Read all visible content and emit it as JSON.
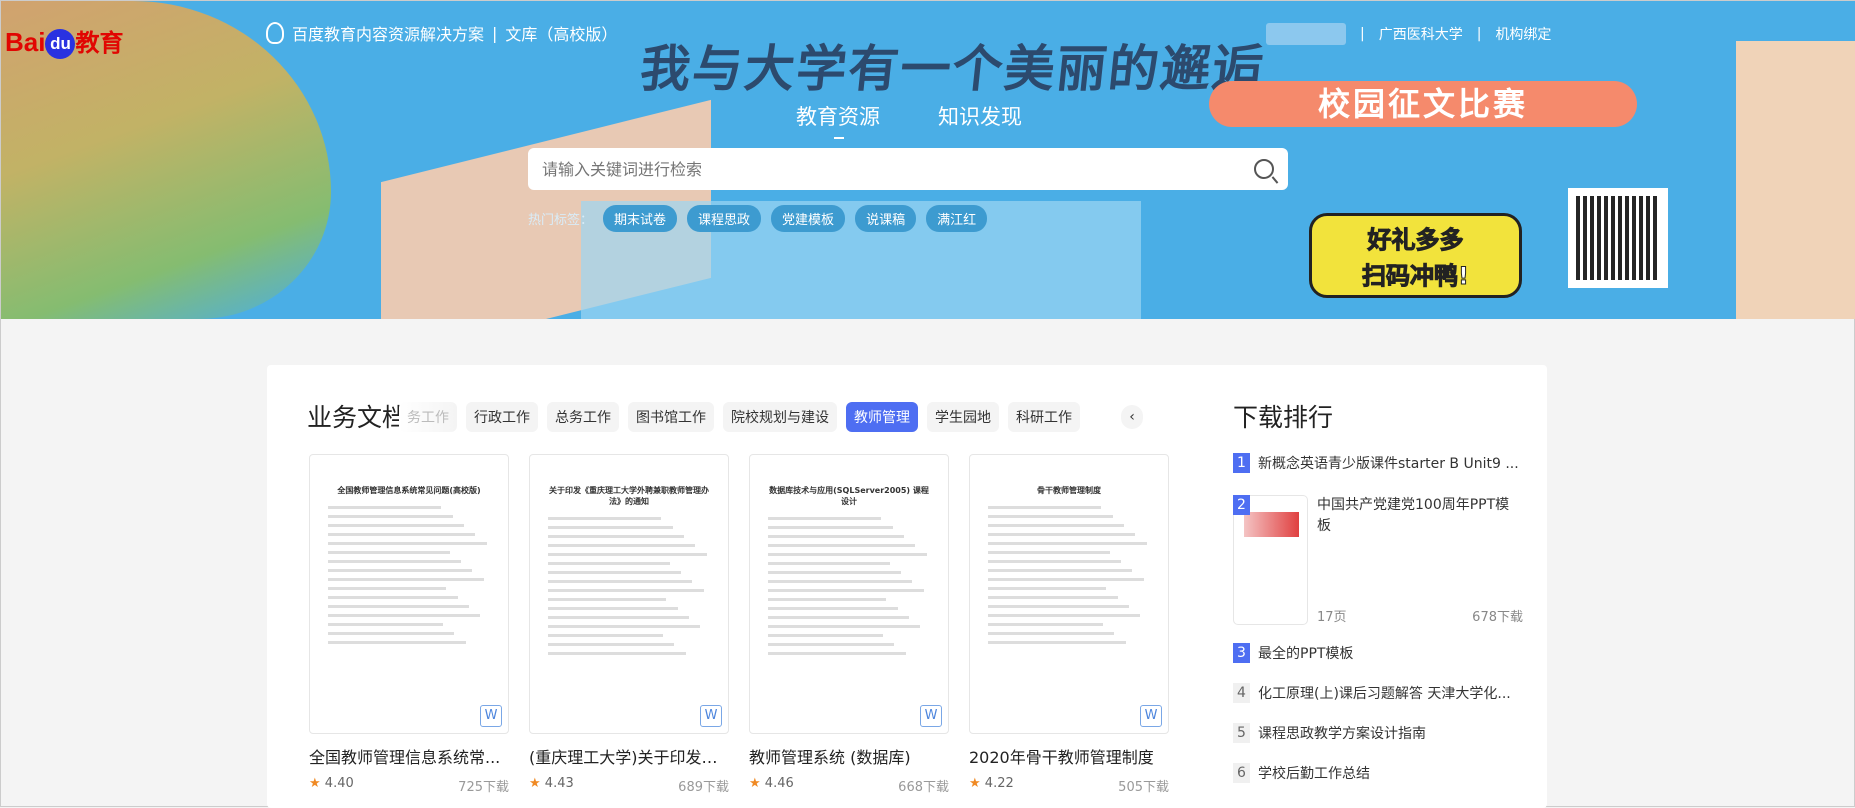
{
  "header": {
    "brand": "Bai",
    "brand_du": "du",
    "brand_edu": "教育",
    "solution": "百度教育内容资源解决方案",
    "separator": "|",
    "library": "文库（高校版）",
    "school": "广西医科大学",
    "bind": "机构绑定"
  },
  "banner": {
    "headline": "我与大学有一个美丽的邂逅",
    "contest": "校园征文比赛",
    "gift_line1": "好礼多多",
    "gift_line2": "扫码冲鸭!"
  },
  "nav": {
    "tabs": [
      {
        "label": "教育资源",
        "active": true
      },
      {
        "label": "知识发现",
        "active": false
      }
    ]
  },
  "search": {
    "placeholder": "请输入关键词进行检索",
    "value": ""
  },
  "hot_tags": {
    "label": "热门标签：",
    "tags": [
      "期末试卷",
      "课程思政",
      "党建模板",
      "说课稿",
      "满江红"
    ]
  },
  "section": {
    "title": "业务文档",
    "categories": [
      {
        "label": "务工作",
        "faded": true
      },
      {
        "label": "行政工作"
      },
      {
        "label": "总务工作"
      },
      {
        "label": "图书馆工作"
      },
      {
        "label": "院校规划与建设"
      },
      {
        "label": "教师管理",
        "active": true
      },
      {
        "label": "学生园地"
      },
      {
        "label": "科研工作"
      }
    ],
    "prev": "‹"
  },
  "documents": [
    {
      "thumb_title": "全国教师管理信息系统常见问题(高校版)",
      "title": "全国教师管理信息系统常...",
      "rating": "4.40",
      "downloads": "725下载",
      "type": "W"
    },
    {
      "thumb_title": "关于印发《重庆理工大学外聘兼职教师管理办法》的通知",
      "title": "(重庆理工大学)关于印发《...",
      "rating": "4.43",
      "downloads": "689下载",
      "type": "W"
    },
    {
      "thumb_title": "数据库技术与应用(SQLServer2005) 课程设计",
      "title": "教师管理系统 (数据库)",
      "rating": "4.46",
      "downloads": "668下载",
      "type": "W"
    },
    {
      "thumb_title": "骨干教师管理制度",
      "title": "2020年骨干教师管理制度",
      "rating": "4.22",
      "downloads": "505下载",
      "type": "W"
    }
  ],
  "ranking": {
    "title": "下载排行",
    "items": [
      {
        "rank": "1",
        "title": "新概念英语青少版课件starter B Unit9 ..."
      },
      {
        "rank": "2",
        "title": "中国共产党建党100周年PPT模板",
        "pages": "17页",
        "downloads": "678下载"
      },
      {
        "rank": "3",
        "title": "最全的PPT模板"
      },
      {
        "rank": "4",
        "title": "化工原理(上)课后习题解答 天津大学化..."
      },
      {
        "rank": "5",
        "title": "课程思政教学方案设计指南"
      },
      {
        "rank": "6",
        "title": "学校后勤工作总结"
      }
    ]
  },
  "colors": {
    "accent": "#4e6ef2",
    "banner": "#4aaee6",
    "contest": "#f58a6c",
    "star": "#f08a24"
  }
}
